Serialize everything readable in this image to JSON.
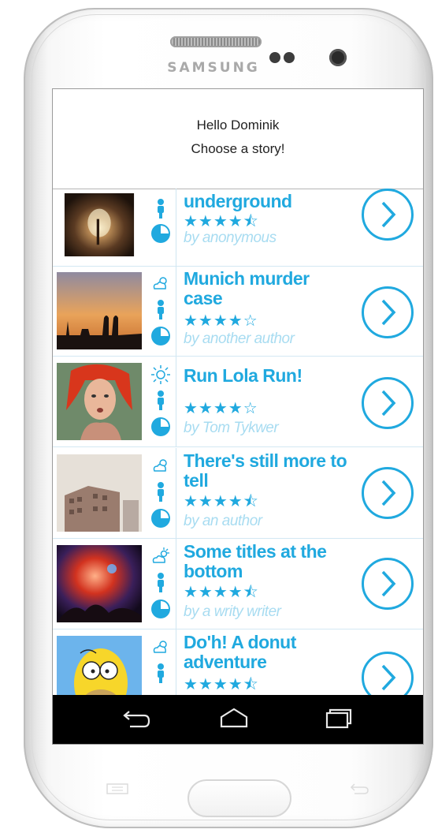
{
  "device": {
    "brand": "SAMSUNG"
  },
  "header": {
    "greeting": "Hello Dominik",
    "prompt": "Choose a story!"
  },
  "colors": {
    "accent": "#20a9df",
    "author": "#a8dcf1",
    "background": "#ffffff",
    "navbar": "#000000"
  },
  "stories": [
    {
      "title_line1": "underground",
      "title_line2": "",
      "stars": "★★★★⯪",
      "rating": 4.5,
      "author": "by anonymous",
      "weather_icon": "",
      "person_icon": "person-icon",
      "time_icon": "clock-icon",
      "thumb": "tunnel"
    },
    {
      "title_line1": "Munich murder",
      "title_line2": "case",
      "stars": "★★★★☆",
      "rating": 4,
      "author": "by another author",
      "weather_icon": "cloud-sun-icon",
      "person_icon": "person-icon",
      "time_icon": "clock-icon",
      "thumb": "munich-skyline"
    },
    {
      "title_line1": "Run Lola Run!",
      "title_line2": "",
      "stars": "★★★★☆",
      "rating": 4,
      "author": "by Tom Tykwer",
      "weather_icon": "sun-icon",
      "person_icon": "person-icon",
      "time_icon": "clock-icon",
      "thumb": "red-hair-woman"
    },
    {
      "title_line1": "There's still more to",
      "title_line2": "tell",
      "stars": "★★★★⯪",
      "rating": 4.5,
      "author": "by an author",
      "weather_icon": "cloud-sun-icon",
      "person_icon": "person-icon",
      "time_icon": "clock-icon",
      "thumb": "building"
    },
    {
      "title_line1": "Some titles at the",
      "title_line2": "bottom",
      "stars": "★★★★⯪",
      "rating": 4.5,
      "author": "by a writy writer",
      "weather_icon": "sun-cloud-icon",
      "person_icon": "person-icon",
      "time_icon": "clock-icon",
      "thumb": "concert"
    },
    {
      "title_line1": "Do'h! A donut",
      "title_line2": "adventure",
      "stars": "★★★★⯪",
      "rating": 4.5,
      "author": "",
      "weather_icon": "cloud-sun-icon",
      "person_icon": "person-icon",
      "time_icon": "clock-icon",
      "thumb": "homer"
    }
  ],
  "navbar": {
    "back": "back-icon",
    "home": "home-icon",
    "recents": "recents-icon"
  }
}
